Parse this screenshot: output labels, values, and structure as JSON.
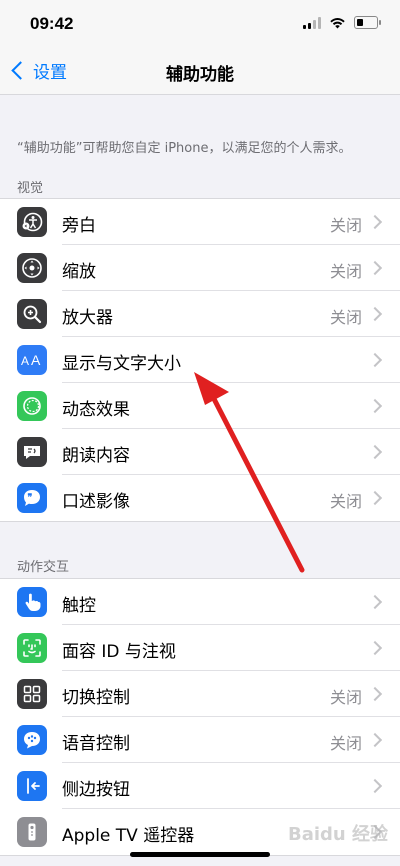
{
  "status": {
    "time": "09:42"
  },
  "nav": {
    "back_label": "设置",
    "title": "辅助功能"
  },
  "intro": "“辅助功能”可帮助您自定 iPhone，以满足您的个人需求。",
  "sections": [
    {
      "header": "视觉",
      "items": [
        {
          "label": "旁白",
          "value": "关闭",
          "icon": "voiceover-icon",
          "color": "#3a3a3c"
        },
        {
          "label": "缩放",
          "value": "关闭",
          "icon": "zoom-icon",
          "color": "#3a3a3c"
        },
        {
          "label": "放大器",
          "value": "关闭",
          "icon": "magnifier-icon",
          "color": "#3a3a3c"
        },
        {
          "label": "显示与文字大小",
          "value": "",
          "icon": "text-size-icon",
          "color": "#2f7cf6"
        },
        {
          "label": "动态效果",
          "value": "",
          "icon": "motion-icon",
          "color": "#34c759"
        },
        {
          "label": "朗读内容",
          "value": "",
          "icon": "spoken-content-icon",
          "color": "#3a3a3c"
        },
        {
          "label": "口述影像",
          "value": "关闭",
          "icon": "audio-description-icon",
          "color": "#1e76f2"
        }
      ]
    },
    {
      "header": "动作交互",
      "items": [
        {
          "label": "触控",
          "value": "",
          "icon": "touch-icon",
          "color": "#1e76f2"
        },
        {
          "label": "面容 ID 与注视",
          "value": "",
          "icon": "face-id-icon",
          "color": "#34c759"
        },
        {
          "label": "切换控制",
          "value": "关闭",
          "icon": "switch-control-icon",
          "color": "#3a3a3c"
        },
        {
          "label": "语音控制",
          "value": "关闭",
          "icon": "voice-control-icon",
          "color": "#1e76f2"
        },
        {
          "label": "侧边按钮",
          "value": "",
          "icon": "side-button-icon",
          "color": "#1e76f2"
        },
        {
          "label": "Apple TV 遥控器",
          "value": "",
          "icon": "apple-tv-remote-icon",
          "color": "#8e8e93"
        }
      ]
    }
  ],
  "watermark": "Baidu 经验"
}
